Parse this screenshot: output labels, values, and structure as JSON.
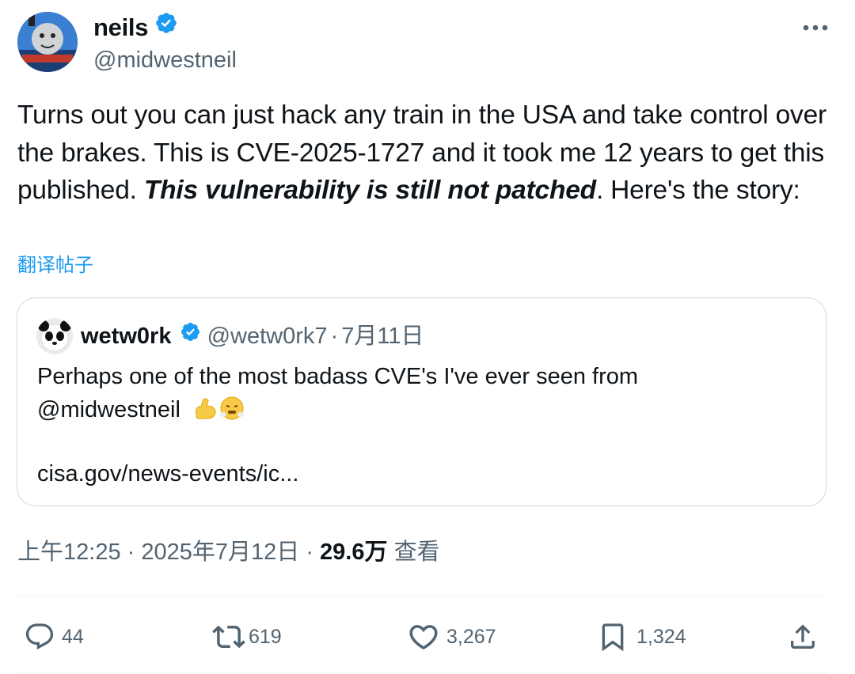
{
  "author": {
    "display_name": "neils",
    "handle": "@midwestneil",
    "verified": true
  },
  "tweet": {
    "text_part1": "Turns out you can just hack any train in the USA and take control over the brakes. This is CVE-2025-1727 and it took me 12 years to get this published. ",
    "text_emphasis": "This vulnerability is still not patched",
    "text_part2": ". Here's the story:",
    "translate_label": "翻译帖子"
  },
  "quote": {
    "display_name": "wetw0rk",
    "handle": "@wetw0rk7",
    "separator": "·",
    "date": "7月11日",
    "text_line1": "Perhaps one of the most badass CVE's I've ever seen from",
    "text_mention": "@midwestneil",
    "link": "cisa.gov/news-events/ic..."
  },
  "meta": {
    "time": "上午12:25",
    "separator": " · ",
    "date": "2025年7月12日",
    "views_count": "29.6万",
    "views_label": "查看"
  },
  "actions": {
    "replies": "44",
    "reposts": "619",
    "likes": "3,267",
    "bookmarks": "1,324"
  },
  "icons": [
    "verified-badge-icon",
    "more-options-icon",
    "reply-icon",
    "repost-icon",
    "like-icon",
    "bookmark-icon",
    "share-icon",
    "flexed-biceps-emoji",
    "face-with-steam-emoji"
  ],
  "colors": {
    "accent": "#1d9bf0",
    "text": "#0f1419",
    "secondary": "#536471",
    "border": "#cfd9de"
  }
}
